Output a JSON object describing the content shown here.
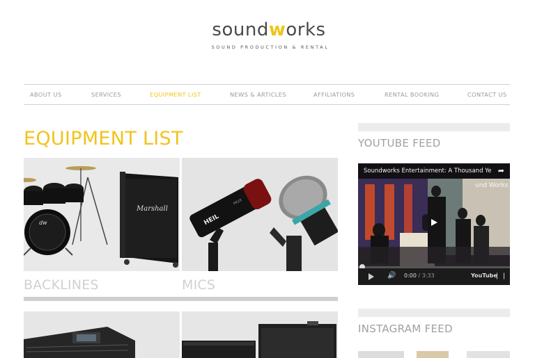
{
  "brand": {
    "logo_pre": "sound",
    "logo_w": "w",
    "logo_post": "orks",
    "tagline": "SOUND PRODUCTION & RENTAL",
    "accent": "#f0c419"
  },
  "nav": {
    "items": [
      {
        "label": "ABOUT US"
      },
      {
        "label": "SERVICES"
      },
      {
        "label": "EQUIPMENT LIST"
      },
      {
        "label": "NEWS & ARTICLES"
      },
      {
        "label": "AFFILIATIONS"
      },
      {
        "label": "RENTAL BOOKING"
      },
      {
        "label": "CONTACT US"
      }
    ],
    "active_label": "EQUIPMENT LIST"
  },
  "main": {
    "title": "EQUIPMENT LIST",
    "tiles": [
      {
        "label": "BACKLINES",
        "image": "drum-kit-and-amp"
      },
      {
        "label": "MICS",
        "image": "microphones",
        "mic_brand": "HEIL",
        "mic_model": "PR28"
      },
      {
        "label": "",
        "image": "mixing-console"
      },
      {
        "label": "",
        "image": "speaker-cabinets"
      }
    ],
    "amp_brand": "Marshall"
  },
  "sidebar": {
    "youtube_title": "YOUTUBE FEED",
    "video": {
      "title": "Soundworks Entertainment: A Thousand Ye",
      "overlay_text": "und Works",
      "time_current": "0:00",
      "time_total": " / 3:33",
      "logo": "YouTube"
    },
    "instagram_title": "INSTAGRAM FEED"
  }
}
